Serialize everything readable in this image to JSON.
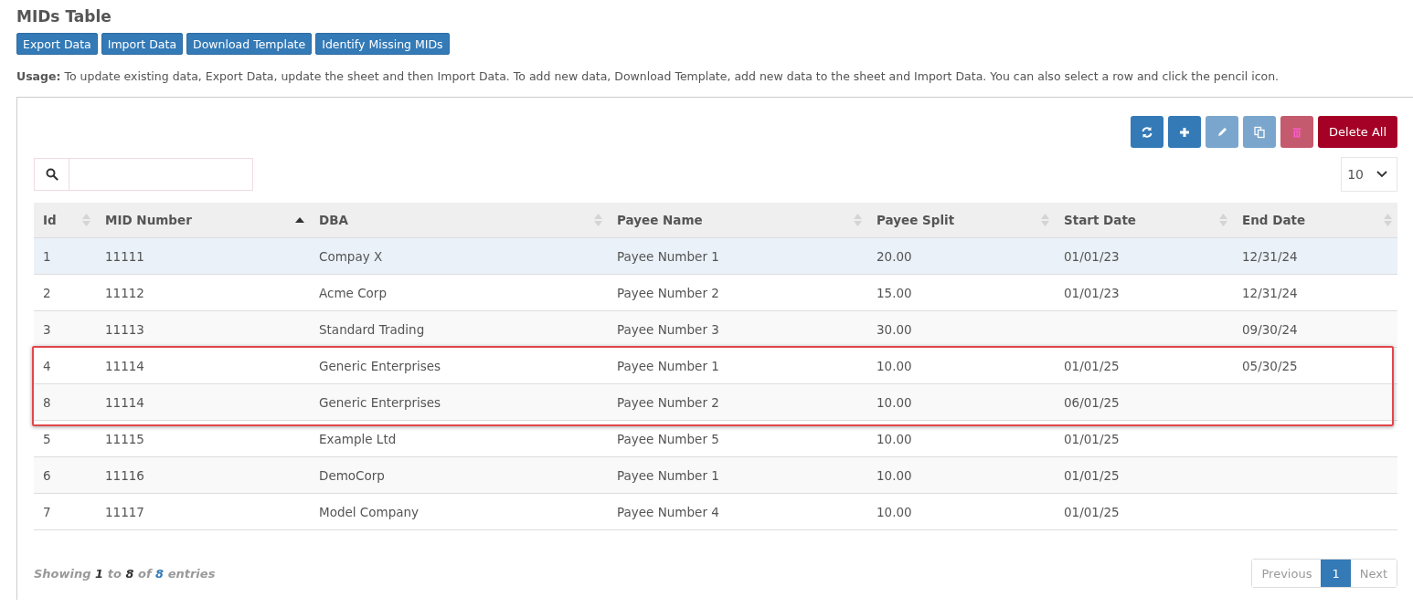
{
  "title": "MIDs Table",
  "actions": [
    "Export Data",
    "Import Data",
    "Download Template",
    "Identify Missing MIDs"
  ],
  "usage": "**Usage:** To update existing data, Export Data, update the sheet and then Import Data. To add new data, Download Template, add new data to the sheet and Import Data. You can also select a row and click the pencil icon.",
  "toolbar": [
    {
      "kind": "refresh",
      "disabled": false
    },
    {
      "kind": "add",
      "disabled": false
    },
    {
      "kind": "edit",
      "disabled": true
    },
    {
      "kind": "copy",
      "disabled": true
    },
    {
      "kind": "delete",
      "disabled": true
    },
    {
      "kind": "delete_all",
      "label": "Delete All",
      "disabled": false
    }
  ],
  "page_size": "10",
  "table": {
    "columns": [
      {
        "label": "Id",
        "sorted": false
      },
      {
        "label": "MID Number",
        "sorted": true
      },
      {
        "label": "DBA",
        "sorted": false
      },
      {
        "label": "Payee Name",
        "sorted": false
      },
      {
        "label": "Payee Split",
        "sorted": false
      },
      {
        "label": "Start Date",
        "sorted": false
      },
      {
        "label": "End Date",
        "sorted": false
      }
    ],
    "rows": [
      {
        "cells": [
          "1",
          "11111",
          "Compay X",
          "Payee Number 1",
          "20.00",
          "01/01/23",
          "12/31/24"
        ],
        "selected": true,
        "boxed": false
      },
      {
        "cells": [
          "2",
          "11112",
          "Acme Corp",
          "Payee Number 2",
          "15.00",
          "01/01/23",
          "12/31/24"
        ],
        "selected": false,
        "boxed": false
      },
      {
        "cells": [
          "3",
          "11113",
          "Standard Trading",
          "Payee Number 3",
          "30.00",
          "",
          "09/30/24"
        ],
        "selected": false,
        "boxed": false
      },
      {
        "cells": [
          "4",
          "11114",
          "Generic Enterprises",
          "Payee Number 1",
          "10.00",
          "01/01/25",
          "05/30/25"
        ],
        "selected": false,
        "boxed": true
      },
      {
        "cells": [
          "8",
          "11114",
          "Generic Enterprises",
          "Payee Number 2",
          "10.00",
          "06/01/25",
          ""
        ],
        "selected": false,
        "boxed": true
      },
      {
        "cells": [
          "5",
          "11115",
          "Example Ltd",
          "Payee Number 5",
          "10.00",
          "01/01/25",
          ""
        ],
        "selected": false,
        "boxed": false
      },
      {
        "cells": [
          "6",
          "11116",
          "DemoCorp",
          "Payee Number 1",
          "10.00",
          "01/01/25",
          ""
        ],
        "selected": false,
        "boxed": false
      },
      {
        "cells": [
          "7",
          "11117",
          "Model Company",
          "Payee Number 4",
          "10.00",
          "01/01/25",
          ""
        ],
        "selected": false,
        "boxed": false
      }
    ]
  },
  "info": [
    {
      "kind": "text",
      "text": "Showing"
    },
    {
      "kind": "strong",
      "text": "1"
    },
    {
      "kind": "text",
      "text": "to"
    },
    {
      "kind": "strong",
      "text": "8"
    },
    {
      "kind": "text",
      "text": "of"
    },
    {
      "kind": "total",
      "text": "8"
    },
    {
      "kind": "text",
      "text": "entries"
    }
  ],
  "pagination": [
    {
      "label": "Previous",
      "selected": false
    },
    {
      "label": "1",
      "selected": true
    },
    {
      "label": "Next",
      "selected": false
    }
  ]
}
